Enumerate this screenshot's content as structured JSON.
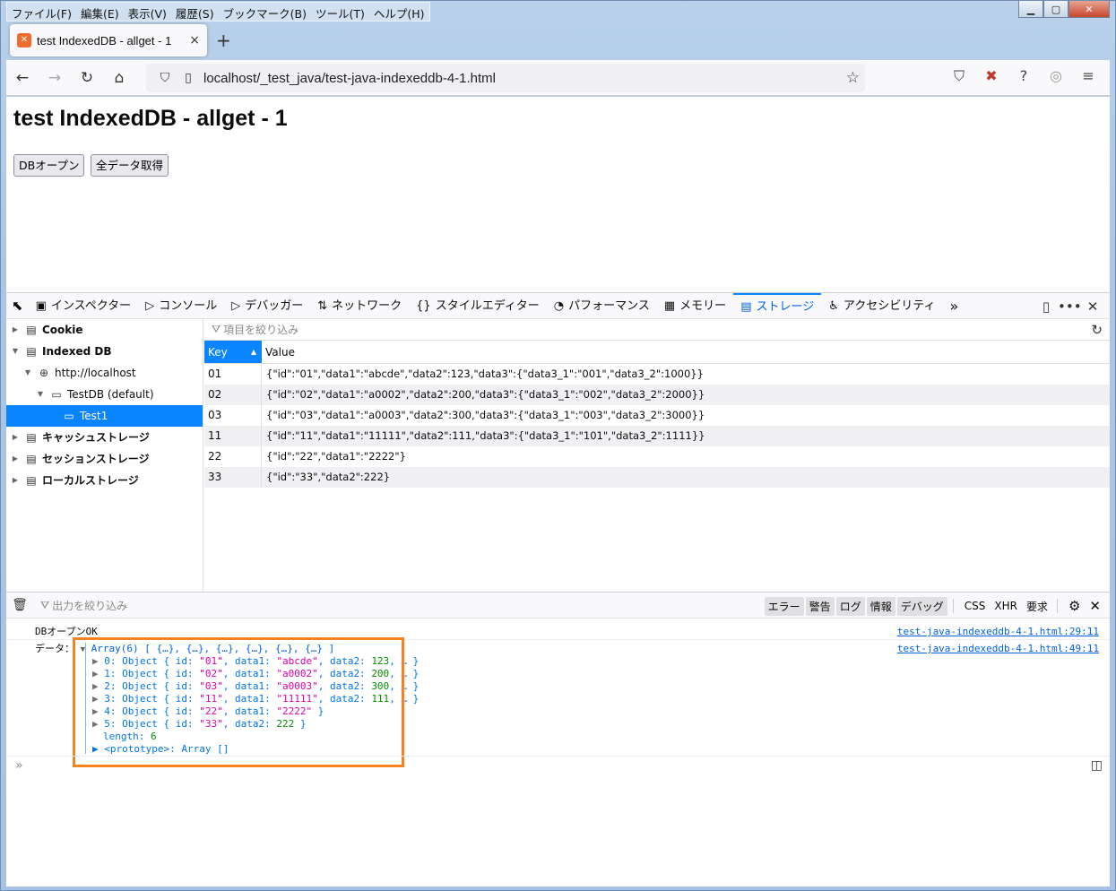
{
  "menubar": [
    "ファイル(F)",
    "編集(E)",
    "表示(V)",
    "履歴(S)",
    "ブックマーク(B)",
    "ツール(T)",
    "ヘルプ(H)"
  ],
  "tab": {
    "title": "test IndexedDB - allget - 1",
    "close": "×"
  },
  "newtab": "+",
  "url": "localhost/_test_java/test-java-indexeddb-4-1.html",
  "page": {
    "heading": "test IndexedDB - allget - 1",
    "btn_open": "DBオープン",
    "btn_getall": "全データ取得"
  },
  "devtools": {
    "tabs": [
      {
        "icon": "▣",
        "label": "インスペクター"
      },
      {
        "icon": "▷",
        "label": "コンソール"
      },
      {
        "icon": "▷",
        "label": "デバッガー"
      },
      {
        "icon": "⇅",
        "label": "ネットワーク"
      },
      {
        "icon": "{}",
        "label": "スタイルエディター"
      },
      {
        "icon": "◔",
        "label": "パフォーマンス"
      },
      {
        "icon": "▦",
        "label": "メモリー"
      },
      {
        "icon": "▤",
        "label": "ストレージ"
      },
      {
        "icon": "♿",
        "label": "アクセシビリティ"
      }
    ],
    "more": "»"
  },
  "storage": {
    "tree": [
      {
        "label": "Cookie"
      },
      {
        "label": "Indexed DB"
      },
      {
        "label": "http://localhost"
      },
      {
        "label": "TestDB (default)"
      },
      {
        "label": "Test1"
      },
      {
        "label": "キャッシュストレージ"
      },
      {
        "label": "セッションストレージ"
      },
      {
        "label": "ローカルストレージ"
      }
    ],
    "filter_placeholder": "項目を絞り込み",
    "col_key": "Key",
    "col_value": "Value",
    "rows": [
      {
        "key": "01",
        "value": "{\"id\":\"01\",\"data1\":\"abcde\",\"data2\":123,\"data3\":{\"data3_1\":\"001\",\"data3_2\":1000}}"
      },
      {
        "key": "02",
        "value": "{\"id\":\"02\",\"data1\":\"a0002\",\"data2\":200,\"data3\":{\"data3_1\":\"002\",\"data3_2\":2000}}"
      },
      {
        "key": "03",
        "value": "{\"id\":\"03\",\"data1\":\"a0003\",\"data2\":300,\"data3\":{\"data3_1\":\"003\",\"data3_2\":3000}}"
      },
      {
        "key": "11",
        "value": "{\"id\":\"11\",\"data1\":\"11111\",\"data2\":111,\"data3\":{\"data3_1\":\"101\",\"data3_2\":1111}}"
      },
      {
        "key": "22",
        "value": "{\"id\":\"22\",\"data1\":\"2222\"}"
      },
      {
        "key": "33",
        "value": "{\"id\":\"33\",\"data2\":222}"
      }
    ]
  },
  "console": {
    "filter_placeholder": "出力を絞り込み",
    "filters": [
      "エラー",
      "警告",
      "ログ",
      "情報",
      "デバッグ"
    ],
    "extra": [
      "CSS",
      "XHR",
      "要求"
    ],
    "line1": {
      "text": "DBオープンOK",
      "loc": "test-java-indexeddb-4-1.html:29:11"
    },
    "line2": {
      "label": "データ：",
      "summary": "Array(6) [ {…}, {…}, {…}, {…}, {…}, {…} ]",
      "loc": "test-java-indexeddb-4-1.html:49:11"
    },
    "items": [
      {
        "idx": "0",
        "id": "\"01\"",
        "d1": "\"abcde\"",
        "d2": "123"
      },
      {
        "idx": "1",
        "id": "\"02\"",
        "d1": "\"a0002\"",
        "d2": "200"
      },
      {
        "idx": "2",
        "id": "\"03\"",
        "d1": "\"a0003\"",
        "d2": "300"
      },
      {
        "idx": "3",
        "id": "\"11\"",
        "d1": "\"11111\"",
        "d2": "111"
      }
    ],
    "item4": {
      "idx": "4",
      "id": "\"22\"",
      "d1": "\"2222\""
    },
    "item5": {
      "idx": "5",
      "id": "\"33\"",
      "d2": "222"
    },
    "length_label": "length: ",
    "length_value": "6",
    "prototype": "<prototype>: Array []"
  },
  "colors": {
    "accent": "#0a84ff",
    "highlight": "#f5821f"
  }
}
